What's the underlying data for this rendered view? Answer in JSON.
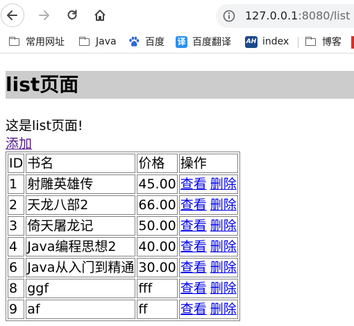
{
  "browser": {
    "url_host": "127.0.0.1",
    "url_port_path": ":8080/list",
    "bookmarks": [
      {
        "label": "常用网址",
        "icon": "folder-icon"
      },
      {
        "label": "Java",
        "icon": "folder-icon"
      },
      {
        "label": "百度",
        "icon": "baidu-paw-icon"
      },
      {
        "label": "百度翻译",
        "icon": "translate-icon",
        "icon_text": "译"
      },
      {
        "label": "index",
        "icon": "ah-icon",
        "icon_text": "AH"
      },
      {
        "label": "博客",
        "icon": "folder-icon"
      }
    ]
  },
  "page": {
    "heading": "list页面",
    "intro": "这是list页面!",
    "add_link": "添加",
    "table": {
      "headers": [
        "ID",
        "书名",
        "价格",
        "操作"
      ],
      "view_label": "查看",
      "delete_label": "删除",
      "rows": [
        {
          "id": "1",
          "name": "射雕英雄传",
          "price": "45.00"
        },
        {
          "id": "2",
          "name": "天龙八部2",
          "price": "66.00"
        },
        {
          "id": "3",
          "name": "倚天屠龙记",
          "price": "50.00"
        },
        {
          "id": "4",
          "name": "Java编程思想2",
          "price": "40.00"
        },
        {
          "id": "6",
          "name": "Java从入门到精通",
          "price": "30.00"
        },
        {
          "id": "8",
          "name": "ggf",
          "price": "fff"
        },
        {
          "id": "9",
          "name": "af",
          "price": "ff"
        }
      ]
    }
  },
  "colors": {
    "heading_bg": "#cccccc",
    "link": "#0000ee",
    "visited_link": "#551a8b",
    "translate_icon_bg": "#2b8ff0",
    "ah_icon_bg": "#1c4a8c",
    "baidu_icon": "#2f68d6"
  }
}
